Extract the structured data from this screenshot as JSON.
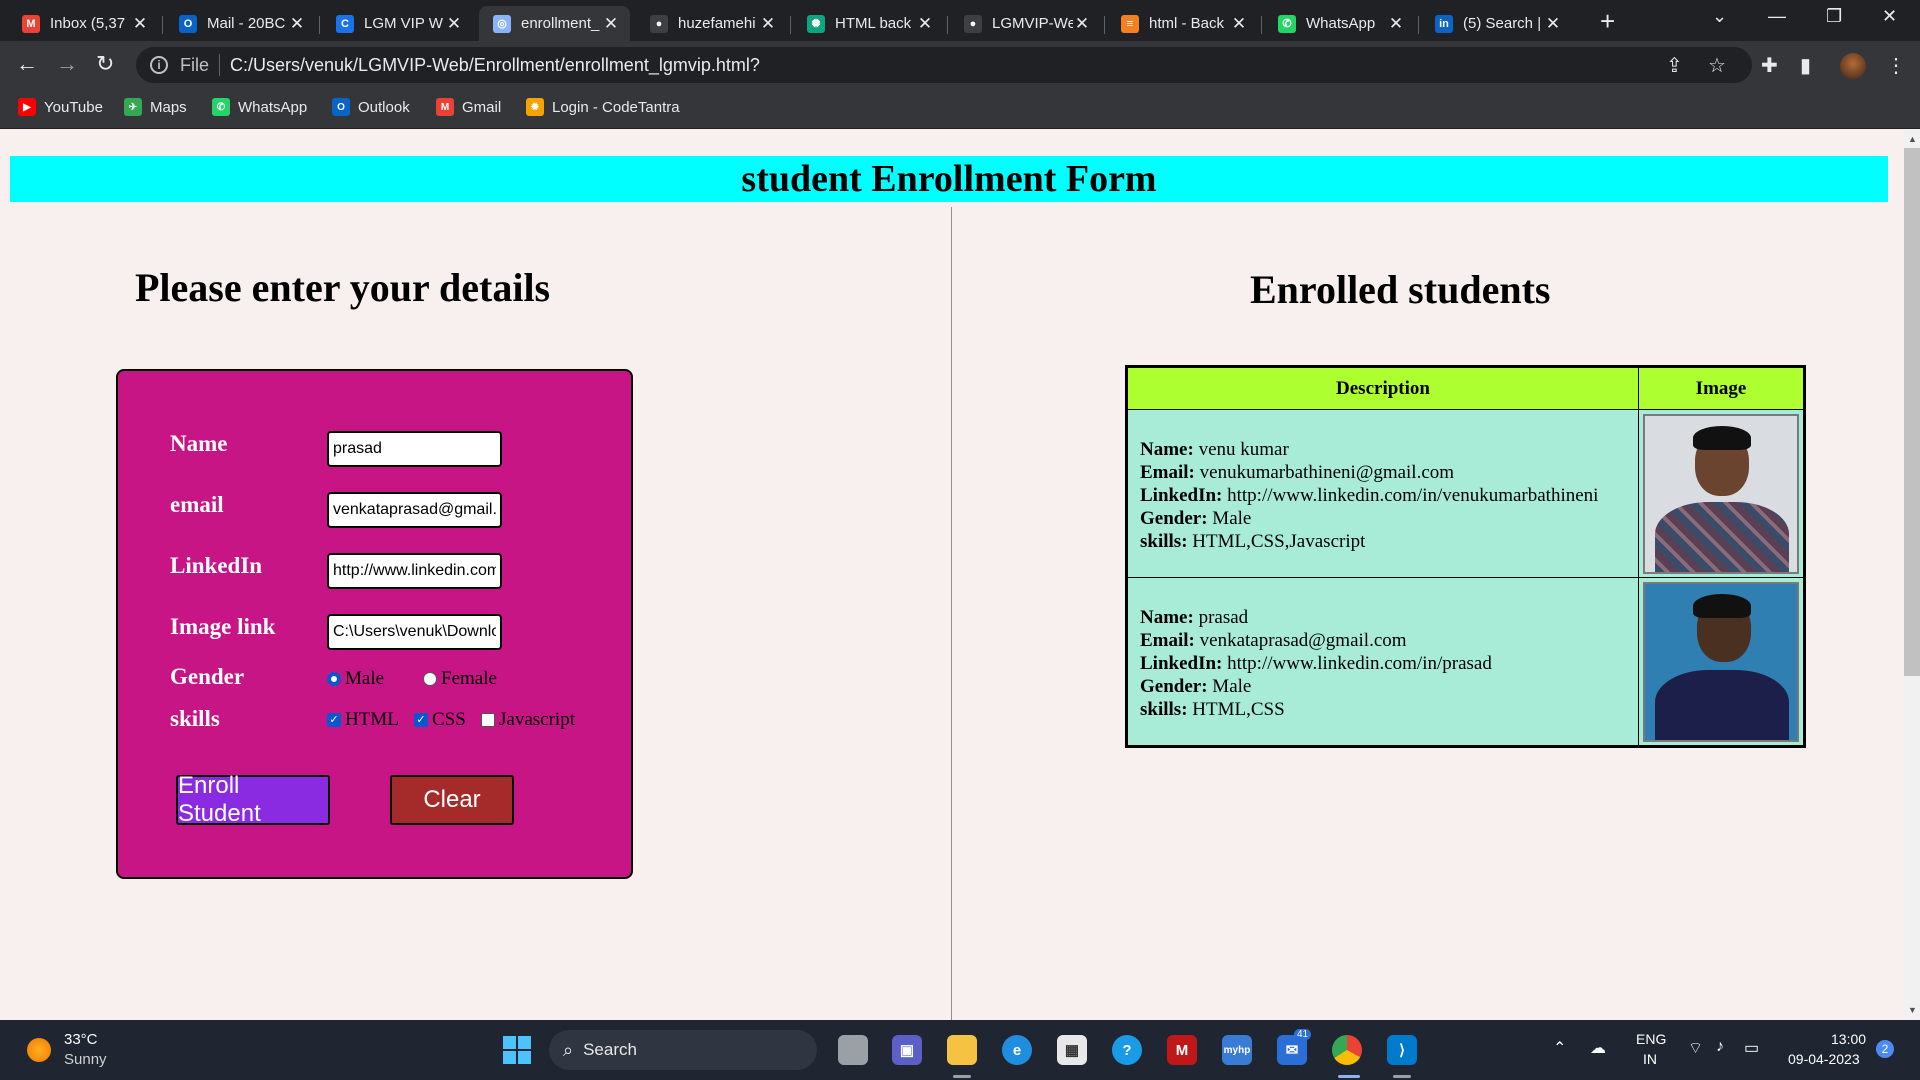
{
  "browser": {
    "tabs": [
      {
        "title": "Inbox (5,37",
        "icon": "gmail-icon",
        "color": "#ea4335",
        "glyph": "M"
      },
      {
        "title": "Mail - 20BC",
        "icon": "outlook-icon",
        "color": "#0a64c8",
        "glyph": "O"
      },
      {
        "title": "LGM VIP W",
        "icon": "lgm-icon",
        "color": "#1a73e8",
        "glyph": "C"
      },
      {
        "title": "enrollment_",
        "icon": "globe-icon",
        "color": "#8ab4f8",
        "glyph": "◎"
      },
      {
        "title": "huzefamehi",
        "icon": "github-icon",
        "color": "#3c4043",
        "glyph": "●"
      },
      {
        "title": "HTML back",
        "icon": "chatgpt-icon",
        "color": "#10a37f",
        "glyph": "✺"
      },
      {
        "title": "LGMVIP-We",
        "icon": "github-icon",
        "color": "#3c4043",
        "glyph": "●"
      },
      {
        "title": "html - Back",
        "icon": "stackoverflow-icon",
        "color": "#f48024",
        "glyph": "≡"
      },
      {
        "title": "WhatsApp",
        "icon": "whatsapp-icon",
        "color": "#25d366",
        "glyph": "✆"
      },
      {
        "title": "(5) Search |",
        "icon": "linkedin-icon",
        "color": "#0a66c2",
        "glyph": "in"
      }
    ],
    "address_scheme": "File",
    "address_url": "C:/Users/venuk/LGMVIP-Web/Enrollment/enrollment_lgmvip.html?",
    "bookmarks": [
      {
        "label": "YouTube",
        "icon": "youtube-icon",
        "color": "#ff0000",
        "glyph": "▶"
      },
      {
        "label": "Maps",
        "icon": "maps-icon",
        "color": "#34a853",
        "glyph": "✈"
      },
      {
        "label": "WhatsApp",
        "icon": "whatsapp-icon",
        "color": "#25d366",
        "glyph": "✆"
      },
      {
        "label": "Outlook",
        "icon": "outlook-icon",
        "color": "#0a64c8",
        "glyph": "O"
      },
      {
        "label": "Gmail",
        "icon": "gmail-icon",
        "color": "#ea4335",
        "glyph": "M"
      },
      {
        "label": "Login - CodeTantra",
        "icon": "codetantra-icon",
        "color": "#f4a300",
        "glyph": "✹"
      }
    ]
  },
  "page": {
    "banner": "student Enrollment Form",
    "form_heading": "Please enter your details",
    "list_heading": "Enrolled students",
    "form": {
      "name_label": "Name",
      "name_value": "prasad",
      "email_label": "email",
      "email_value": "venkataprasad@gmail.com",
      "linkedin_label": "LinkedIn",
      "linkedin_value": "http://www.linkedin.com/in/prasad",
      "image_label": "Image link",
      "image_value": "C:\\Users\\venuk\\Downloads\\",
      "gender_label": "Gender",
      "gender_options": [
        {
          "label": "Male",
          "checked": true
        },
        {
          "label": "Female",
          "checked": false
        }
      ],
      "skills_label": "skills",
      "skills_options": [
        {
          "label": "HTML",
          "checked": true
        },
        {
          "label": "CSS",
          "checked": true
        },
        {
          "label": "Javascript",
          "checked": false
        }
      ],
      "enroll_button": "Enroll Student",
      "clear_button": "Clear",
      "colors": {
        "panel": "#c71585",
        "enroll": "#8a2be2",
        "clear": "#a52a2a"
      }
    },
    "table": {
      "headers": [
        "Description",
        "Image"
      ],
      "field_labels": {
        "name": "Name:",
        "email": "Email:",
        "linkedin": "LinkedIn:",
        "gender": "Gender:",
        "skills": "skills:"
      },
      "rows": [
        {
          "name": "venu kumar",
          "email": "venukumarbathineni@gmail.com",
          "linkedin": "http://www.linkedin.com/in/venukumarbathineni",
          "gender": "Male",
          "skills": "HTML,CSS,Javascript"
        },
        {
          "name": " prasad",
          "email": "venkataprasad@gmail.com",
          "linkedin": "http://www.linkedin.com/in/prasad",
          "gender": "Male",
          "skills": "HTML,CSS"
        }
      ]
    }
  },
  "taskbar": {
    "temperature": "33°C",
    "condition": "Sunny",
    "search_placeholder": "Search",
    "language": "ENG",
    "region": "IN",
    "time": "13:00",
    "date": "09-04-2023",
    "notification_count": "2",
    "teams_badge": "41"
  }
}
